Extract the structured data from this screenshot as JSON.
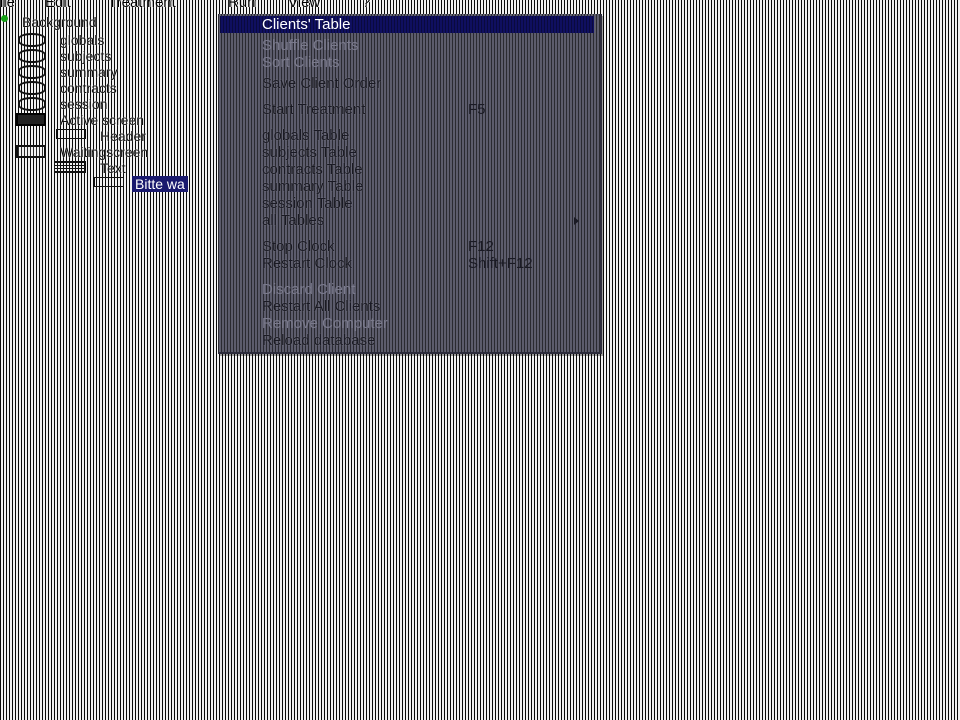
{
  "menubar": {
    "items": [
      "ile",
      "Edit",
      "Treatment",
      "Run",
      "View",
      "?"
    ]
  },
  "tree": {
    "background": "Background",
    "tables": [
      "globals",
      "subjects",
      "summary",
      "contracts",
      "session"
    ],
    "active_screen": "Active screen",
    "header": "Header",
    "waiting_screen": "Waitingscreen",
    "text": "Text",
    "selected_item": "Bitte wa"
  },
  "dropdown": {
    "clients_table": "Clients' Table",
    "shuffle_clients": "Shuffle Clients",
    "sort_clients": "Sort Clients",
    "save_client_order": "Save Client Order",
    "start_treatment": "Start Treatment",
    "start_treatment_shortcut": "F5",
    "globals_table": "globals Table",
    "subjects_table": "subjects Table",
    "contracts_table": "contracts Table",
    "summary_table": "summary Table",
    "session_table": "session Table",
    "all_tables": "all Tables",
    "stop_clock": "Stop Clock",
    "stop_clock_shortcut": "F12",
    "restart_clock": "Restart Clock",
    "restart_clock_shortcut": "Shift+F12",
    "discard_client": "Discard Client",
    "restart_all_clients": "Restart All Clients",
    "remove_computer": "Remove Computer",
    "reload_database": "Reload database"
  },
  "colors": {
    "highlight": "#0f0f60",
    "menu_bg": "#5c5c6c",
    "selection": "#1a1a6e",
    "status_dot": "#16a016"
  }
}
